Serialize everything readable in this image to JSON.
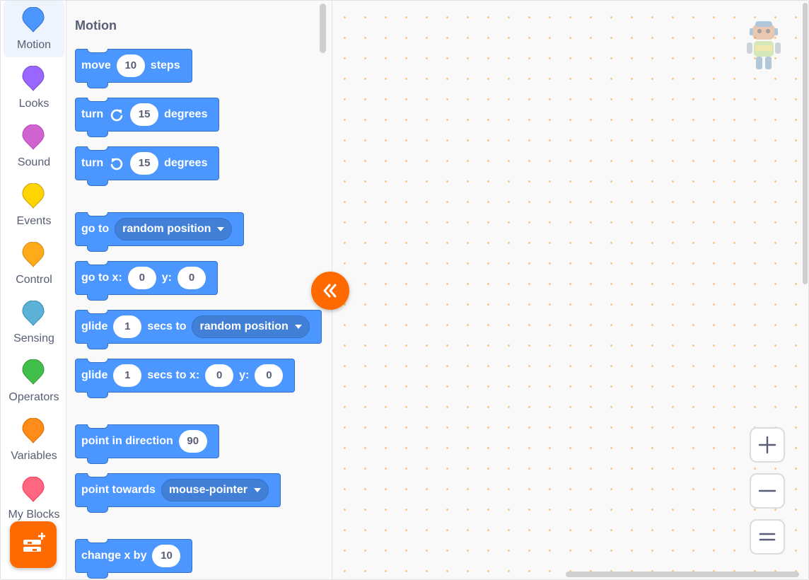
{
  "categories": [
    {
      "label": "Motion",
      "color": "#4c97ff",
      "active": true
    },
    {
      "label": "Looks",
      "color": "#9966ff"
    },
    {
      "label": "Sound",
      "color": "#cf63cf"
    },
    {
      "label": "Events",
      "color": "#ffd500"
    },
    {
      "label": "Control",
      "color": "#ffab19"
    },
    {
      "label": "Sensing",
      "color": "#5cb1d6"
    },
    {
      "label": "Operators",
      "color": "#40bf4a"
    },
    {
      "label": "Variables",
      "color": "#ff8c1a"
    },
    {
      "label": "My Blocks",
      "color": "#ff6680"
    }
  ],
  "palette": {
    "title": "Motion",
    "blocks": {
      "move": {
        "t1": "move",
        "v1": "10",
        "t2": "steps"
      },
      "turn_right": {
        "t1": "turn",
        "v1": "15",
        "t2": "degrees",
        "icon": "rotate-right-icon"
      },
      "turn_left": {
        "t1": "turn",
        "v1": "15",
        "t2": "degrees",
        "icon": "rotate-left-icon"
      },
      "go_to": {
        "t1": "go to",
        "dd": "random position"
      },
      "go_to_xy": {
        "t1": "go to x:",
        "v1": "0",
        "t2": "y:",
        "v2": "0"
      },
      "glide_to": {
        "t1": "glide",
        "v1": "1",
        "t2": "secs to",
        "dd": "random position"
      },
      "glide_xy": {
        "t1": "glide",
        "v1": "1",
        "t2": "secs to x:",
        "v2": "0",
        "t3": "y:",
        "v3": "0"
      },
      "point_dir": {
        "t1": "point in direction",
        "v1": "90"
      },
      "point_towards": {
        "t1": "point towards",
        "dd": "mouse-pointer"
      },
      "change_x": {
        "t1": "change x by",
        "v1": "10"
      }
    }
  },
  "theme": {
    "accent": "#ff6a00",
    "motion_block": "#4c97ff"
  }
}
